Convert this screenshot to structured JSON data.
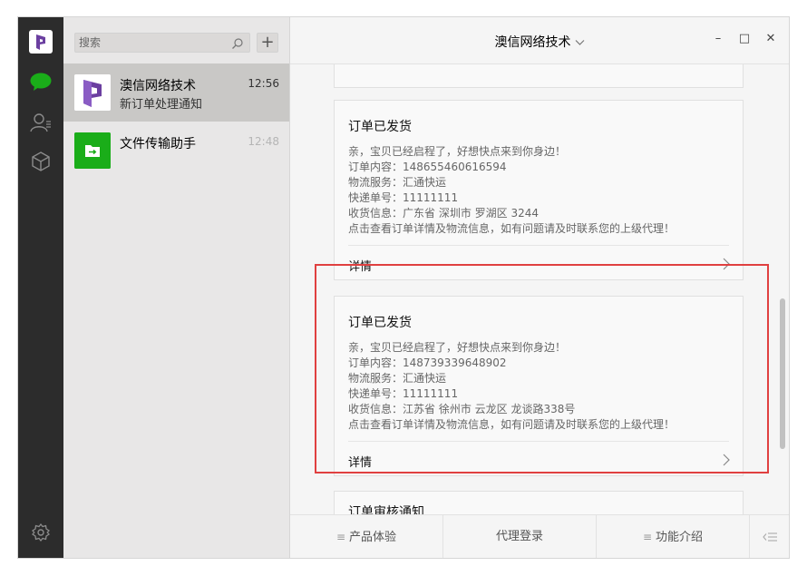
{
  "sidebar": {
    "icons": [
      "app-logo",
      "chat-icon",
      "contacts-icon",
      "favorites-icon",
      "settings-icon"
    ]
  },
  "sessions": {
    "search_placeholder": "搜索",
    "add_label": "+",
    "items": [
      {
        "name": "澳信网络技术",
        "preview": "新订单处理通知",
        "time": "12:56"
      },
      {
        "name": "文件传输助手",
        "preview": "",
        "time": "12:48"
      }
    ]
  },
  "main": {
    "title": "澳信网络技术",
    "window_buttons": [
      "–",
      "□",
      "✕"
    ],
    "cards": [
      {
        "title": "订单已发货",
        "lines": [
          "亲，宝贝已经启程了，好想快点来到你身边！",
          "订单内容：148655460616594",
          "物流服务：汇通快运",
          "快递单号：11111111",
          "收货信息：广东省 深圳市 罗湖区 3244",
          "点击查看订单详情及物流信息，如有问题请及时联系您的上级代理！"
        ],
        "detail": "详情"
      },
      {
        "title": "订单已发货",
        "lines": [
          "亲，宝贝已经启程了，好想快点来到你身边！",
          "订单内容：148739339648902",
          "物流服务：汇通快运",
          "快递单号：11111111",
          "收货信息：江苏省 徐州市 云龙区 龙谈路338号",
          "点击查看订单详情及物流信息，如有问题请及时联系您的上级代理！"
        ],
        "detail": "详情"
      },
      {
        "title": "订单审核通知"
      }
    ],
    "menu": [
      "产品体验",
      "代理登录",
      "功能介绍"
    ]
  },
  "colors": {
    "sidebar_bg": "#2c2c2c",
    "accent_green": "#1aad19",
    "highlight_red": "#e04040",
    "logo_purple": "#6b3fa0"
  }
}
